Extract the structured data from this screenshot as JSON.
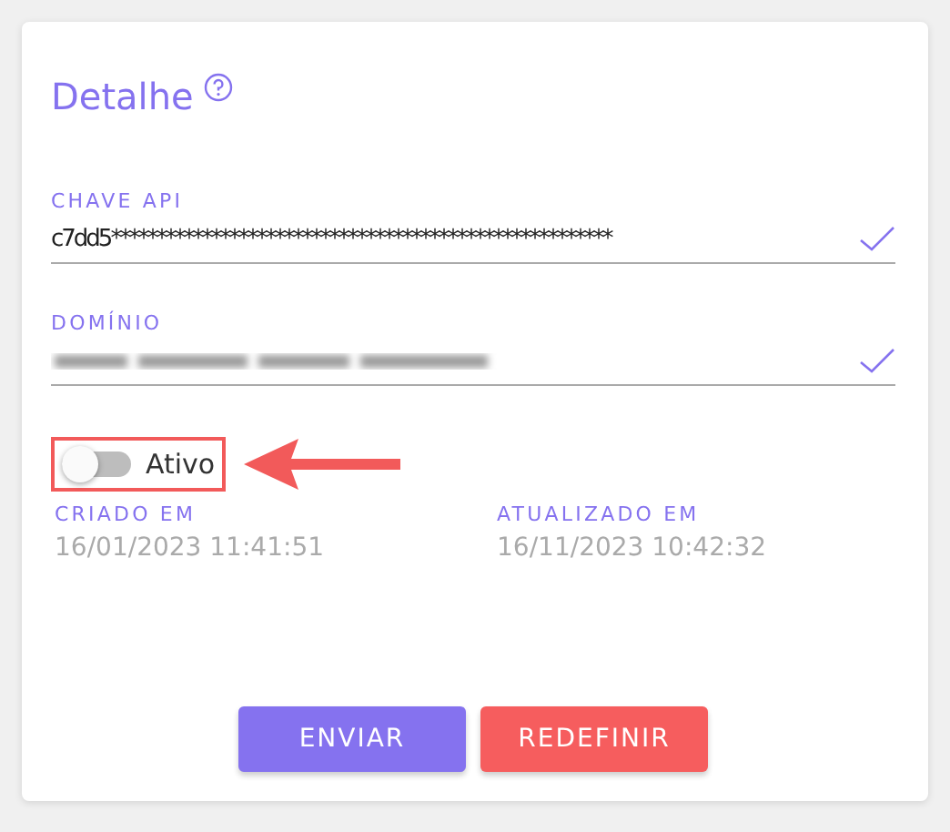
{
  "title": "Detalhe",
  "fields": [
    {
      "label": "CHAVE API",
      "value": "c7dd5*******************************************************",
      "kind": "text"
    },
    {
      "label": "DOMÍNIO",
      "kind": "blurred"
    }
  ],
  "toggle": {
    "label": "Ativo",
    "on": false,
    "highlighted": true
  },
  "dates": [
    {
      "label": "CRIADO EM",
      "value": "16/01/2023 11:41:51"
    },
    {
      "label": "ATUALIZADO EM",
      "value": "16/11/2023 10:42:32"
    }
  ],
  "buttons": [
    {
      "label": "ENVIAR",
      "kind": "primary"
    },
    {
      "label": "REDEFINIR",
      "kind": "danger"
    }
  ]
}
